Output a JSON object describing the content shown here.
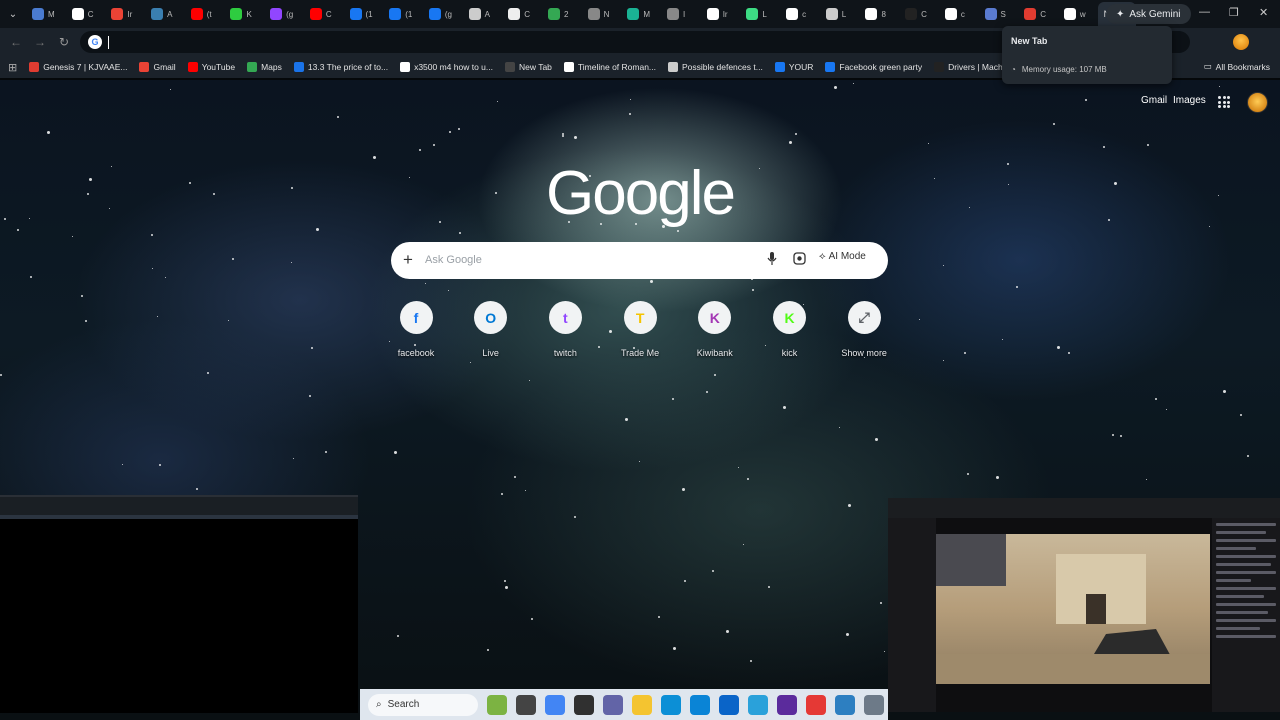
{
  "window": {
    "active_tab_short": "N",
    "new_tab_symbol": "+",
    "gemini_label": "Ask Gemini",
    "tabs": [
      {
        "short": "M",
        "color": "#4a7bd0"
      },
      {
        "short": "C",
        "color": "#ffffff"
      },
      {
        "short": "Ir",
        "color": "#ea4335"
      },
      {
        "short": "A",
        "color": "#3a7fb0"
      },
      {
        "short": "(t",
        "color": "#ff0000"
      },
      {
        "short": "K",
        "color": "#2ecc40"
      },
      {
        "short": "(g",
        "color": "#9146ff"
      },
      {
        "short": "C",
        "color": "#ff0000"
      },
      {
        "short": "(1",
        "color": "#1877f2"
      },
      {
        "short": "(1",
        "color": "#1877f2"
      },
      {
        "short": "(g",
        "color": "#1877f2"
      },
      {
        "short": "A",
        "color": "#cccccc"
      },
      {
        "short": "C",
        "color": "#eeeeee"
      },
      {
        "short": "2",
        "color": "#34a853"
      },
      {
        "short": "N",
        "color": "#888888"
      },
      {
        "short": "M",
        "color": "#1ab394"
      },
      {
        "short": "I",
        "color": "#888888"
      },
      {
        "short": "Ir",
        "color": "#ffffff"
      },
      {
        "short": "L",
        "color": "#3ddc84"
      },
      {
        "short": "c",
        "color": "#ffffff"
      },
      {
        "short": "L",
        "color": "#cccccc"
      },
      {
        "short": "8",
        "color": "#ffffff"
      },
      {
        "short": "C",
        "color": "#222222"
      },
      {
        "short": "c",
        "color": "#ffffff"
      },
      {
        "short": "S",
        "color": "#5a7bd0"
      },
      {
        "short": "C",
        "color": "#e03c31"
      },
      {
        "short": "w",
        "color": "#ffffff"
      }
    ]
  },
  "toolbar": {
    "omnibox_value": ""
  },
  "bookmarks": [
    {
      "label": "Genesis 7 | KJVAAE...",
      "color": "#e03c31"
    },
    {
      "label": "Gmail",
      "color": "#ea4335"
    },
    {
      "label": "YouTube",
      "color": "#ff0000"
    },
    {
      "label": "Maps",
      "color": "#34a853"
    },
    {
      "label": "13.3 The price of to...",
      "color": "#1a73e8"
    },
    {
      "label": "x3500 m4 how to u...",
      "color": "#ffffff"
    },
    {
      "label": "New Tab",
      "color": "#444444"
    },
    {
      "label": "Timeline of Roman...",
      "color": "#ffffff"
    },
    {
      "label": "Possible defences t...",
      "color": "#cccccc"
    },
    {
      "label": "YOUR",
      "color": "#1877f2"
    },
    {
      "label": "Facebook green party",
      "color": "#1877f2"
    },
    {
      "label": "Drivers | Machinist",
      "color": "#222222"
    }
  ],
  "all_bookmarks": "All Bookmarks",
  "hovercard": {
    "title": "New Tab",
    "memory": "Memory usage: 107 MB"
  },
  "ntp": {
    "gmail": "Gmail",
    "images": "Images",
    "logo": "Google",
    "search_placeholder": "Ask Google",
    "ai_mode": "AI Mode",
    "shortcuts": [
      {
        "label": "facebook",
        "glyph": "f",
        "color": "#1877f2"
      },
      {
        "label": "Live",
        "glyph": "O",
        "color": "#0078d4"
      },
      {
        "label": "twitch",
        "glyph": "t",
        "color": "#9146ff"
      },
      {
        "label": "Trade Me",
        "glyph": "T",
        "color": "#f5c400"
      },
      {
        "label": "Kiwibank",
        "glyph": "K",
        "color": "#a336b4"
      },
      {
        "label": "kick",
        "glyph": "K",
        "color": "#53fc18"
      },
      {
        "label": "Show more",
        "glyph": "⤢",
        "color": "#5f6368"
      }
    ]
  },
  "taskbar": {
    "search_label": "Search",
    "icons": [
      {
        "name": "widget",
        "color": "#7cb342"
      },
      {
        "name": "task-view",
        "color": "#444444"
      },
      {
        "name": "chrome",
        "color": "#4285f4"
      },
      {
        "name": "obs",
        "color": "#303030"
      },
      {
        "name": "teams",
        "color": "#6264a7"
      },
      {
        "name": "files",
        "color": "#f4c430"
      },
      {
        "name": "edge",
        "color": "#0c8fd6"
      },
      {
        "name": "store",
        "color": "#0a84d6"
      },
      {
        "name": "outlook",
        "color": "#0a64c8"
      },
      {
        "name": "telegram",
        "color": "#2aa1da"
      },
      {
        "name": "app-purple",
        "color": "#5b2b9c"
      },
      {
        "name": "app-red",
        "color": "#e53935"
      },
      {
        "name": "app-blue",
        "color": "#2d7fc1"
      },
      {
        "name": "settings",
        "color": "#6d7a88"
      }
    ]
  }
}
